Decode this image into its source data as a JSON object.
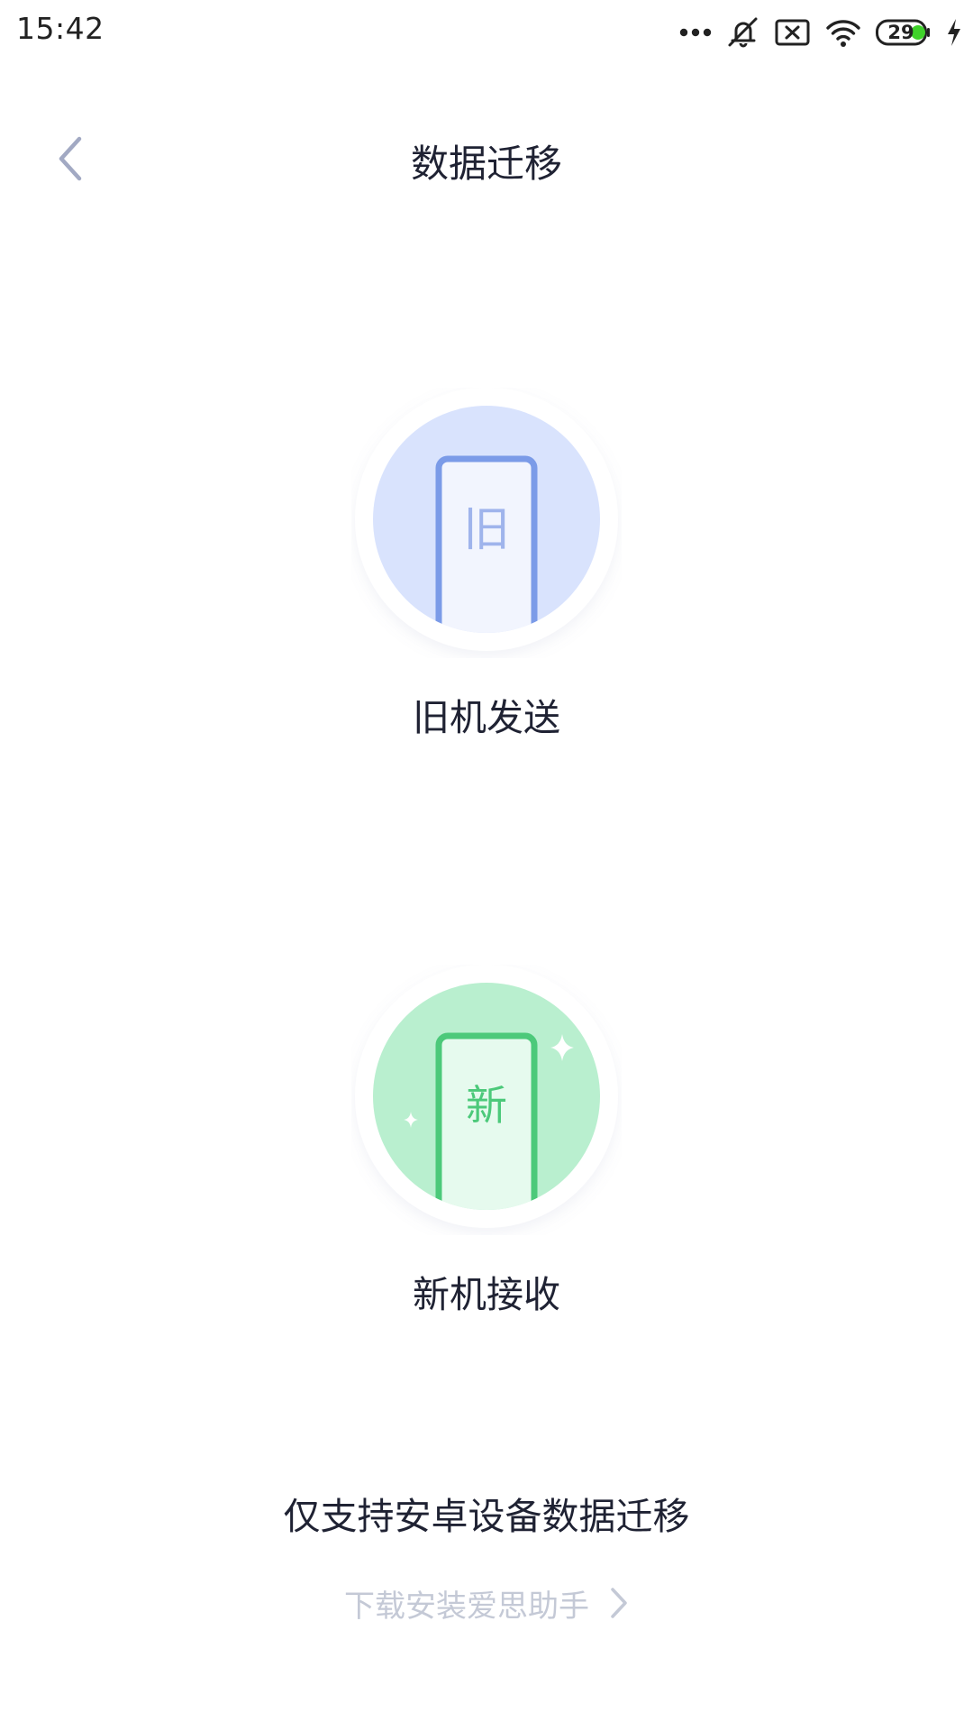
{
  "status_bar": {
    "time": "15:42",
    "battery_level": "29",
    "icons": [
      "more-dots-icon",
      "mute-icon",
      "sim-off-icon",
      "wifi-icon",
      "battery-icon",
      "charging-icon"
    ]
  },
  "header": {
    "title": "数据迁移",
    "back_icon": "chevron-left-icon"
  },
  "options": {
    "old": {
      "badge": "旧",
      "label": "旧机发送",
      "accent": "#7b9be8",
      "circle": "#d9e3fd"
    },
    "new": {
      "badge": "新",
      "label": "新机接收",
      "accent": "#4cc97a",
      "circle": "#b9efcf"
    }
  },
  "footer": {
    "notice": "仅支持安卓设备数据迁移",
    "download_label": "下载安装爱思助手",
    "download_icon": "chevron-right-icon"
  }
}
